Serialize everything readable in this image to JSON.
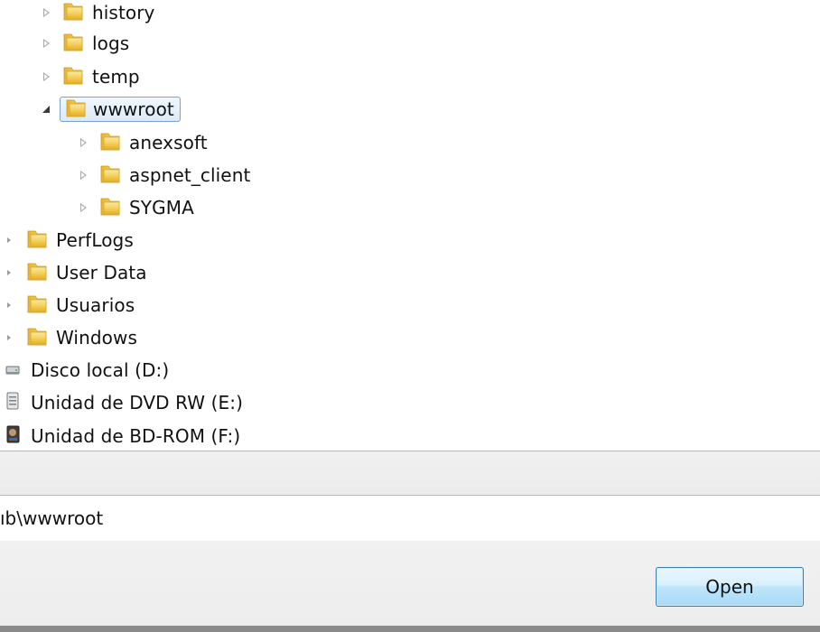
{
  "tree": {
    "nodes": [
      {
        "label": "history",
        "expander": "collapsed",
        "state": "partial"
      },
      {
        "label": "logs",
        "expander": "collapsed"
      },
      {
        "label": "temp",
        "expander": "collapsed"
      },
      {
        "label": "wwwroot",
        "expander": "expanded",
        "selected": true
      },
      {
        "label": "anexsoft",
        "expander": "collapsed"
      },
      {
        "label": "aspnet_client",
        "expander": "collapsed"
      },
      {
        "label": "SYGMA",
        "expander": "collapsed"
      },
      {
        "label": "PerfLogs",
        "expander": "collapsed"
      },
      {
        "label": "User Data",
        "expander": "collapsed"
      },
      {
        "label": "Usuarios",
        "expander": "collapsed"
      },
      {
        "label": "Windows",
        "expander": "collapsed"
      },
      {
        "label": "Disco local (D:)",
        "icon": "hard-drive-icon"
      },
      {
        "label": "Unidad de DVD RW (E:)",
        "icon": "dvd-drive-icon"
      },
      {
        "label": "Unidad de BD-ROM (F:)",
        "icon": "bd-rom-drive-icon"
      }
    ]
  },
  "path_field": {
    "value": "ıb\\wwwroot"
  },
  "buttons": {
    "open": "Open"
  },
  "colors": {
    "folder": "#f2c544",
    "selection_border": "#7da2ce",
    "selection_fill": "#dbeaf8",
    "button_border": "#3c7fb1"
  }
}
